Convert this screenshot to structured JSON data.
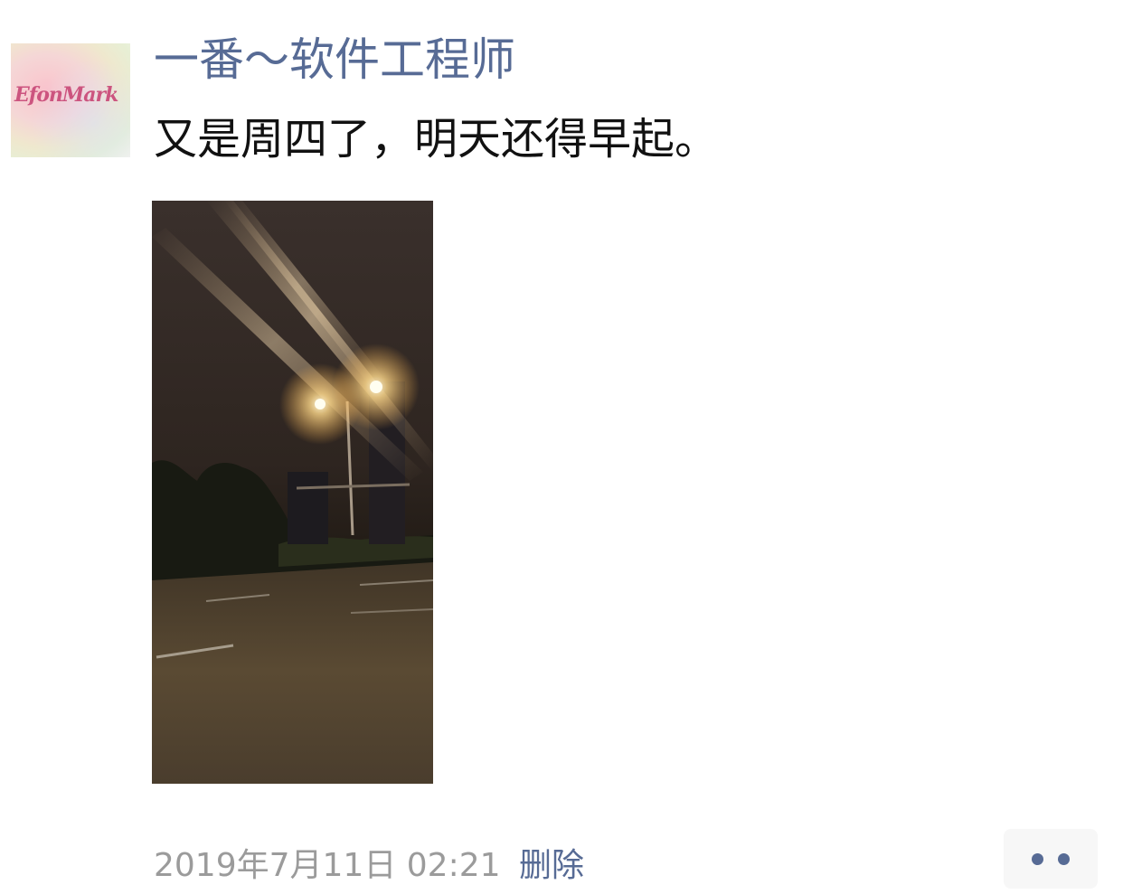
{
  "post": {
    "author": "一番～软件工程师",
    "text": "又是周四了，明天还得早起。",
    "timestamp": "2019年7月11日 02:21",
    "delete_label": "删除"
  },
  "avatar": {
    "logo_text": "EfonMark"
  },
  "photo": {
    "description_icon": "night-street-photo"
  },
  "actions": {
    "more_icon": "more-dots-icon"
  },
  "colors": {
    "link_blue": "#576b95",
    "text_black": "#111111",
    "meta_gray": "#9b9b9b",
    "button_bg": "#f7f7f7"
  }
}
